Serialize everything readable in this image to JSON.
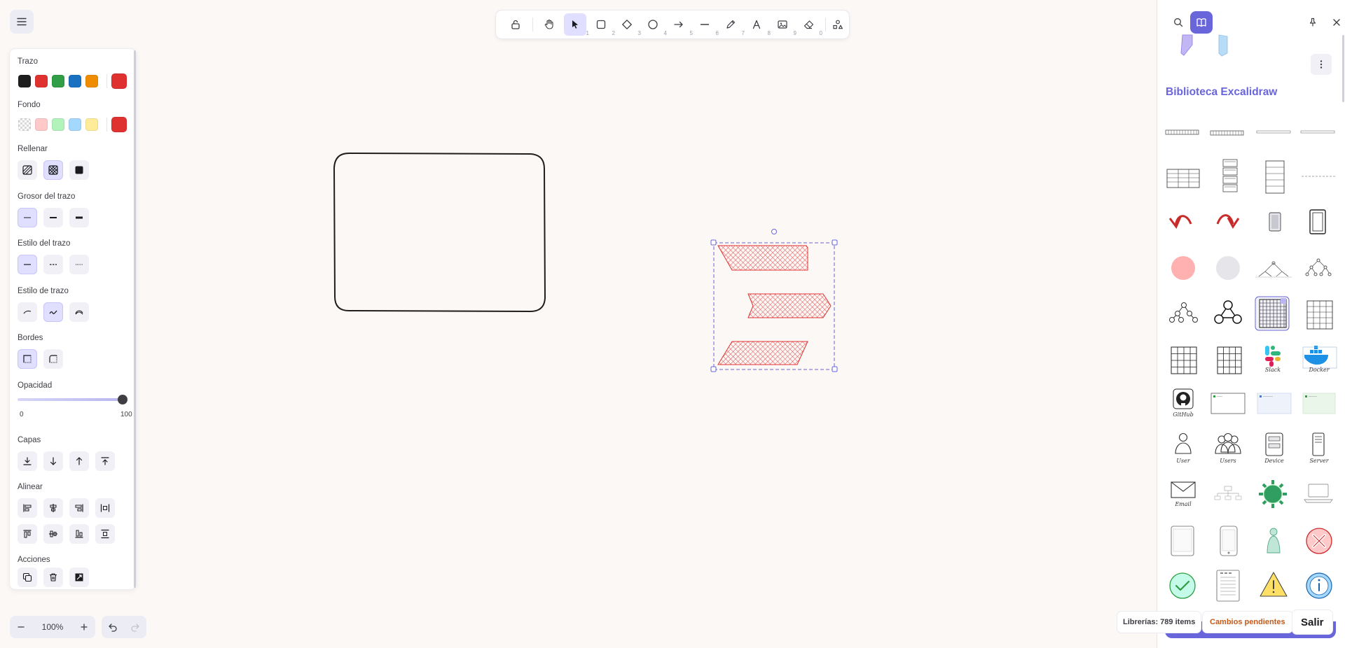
{
  "toolbar": {
    "tools": [
      {
        "name": "lock",
        "key": ""
      },
      {
        "name": "hand",
        "key": ""
      },
      {
        "name": "selection",
        "key": "1",
        "active": true
      },
      {
        "name": "rectangle",
        "key": "2"
      },
      {
        "name": "diamond",
        "key": "3"
      },
      {
        "name": "ellipse",
        "key": "4"
      },
      {
        "name": "arrow",
        "key": "5"
      },
      {
        "name": "line",
        "key": "6"
      },
      {
        "name": "draw",
        "key": "7"
      },
      {
        "name": "text",
        "key": "8"
      },
      {
        "name": "image",
        "key": "9"
      },
      {
        "name": "eraser",
        "key": "0"
      },
      {
        "name": "more-tools",
        "key": ""
      }
    ]
  },
  "props": {
    "stroke": {
      "label": "Trazo",
      "colors": [
        "#1e1e1e",
        "#e03131",
        "#2f9e44",
        "#1971c2",
        "#f08c00"
      ],
      "current": "#e03131"
    },
    "background": {
      "label": "Fondo",
      "colors": [
        "transparent",
        "#ffc9c9",
        "#b2f2bb",
        "#a5d8ff",
        "#ffec99"
      ],
      "current": "#e03131"
    },
    "fill": {
      "label": "Rellenar",
      "active": "cross-hatch"
    },
    "stroke_width": {
      "label": "Grosor del trazo",
      "active": "thin"
    },
    "stroke_style": {
      "label": "Estilo del trazo",
      "active": "solid"
    },
    "sloppiness": {
      "label": "Estilo de trazo",
      "active": "artist"
    },
    "edges": {
      "label": "Bordes",
      "active": "sharp"
    },
    "opacity": {
      "label": "Opacidad",
      "min": "0",
      "max": "100",
      "value": 100
    },
    "layers": {
      "label": "Capas"
    },
    "align": {
      "label": "Alinear"
    },
    "actions": {
      "label": "Acciones"
    }
  },
  "zoom": {
    "value": "100%"
  },
  "library": {
    "title": "Biblioteca Excalidraw",
    "labels": [
      "Slack",
      "Docker",
      "GitHub",
      "User",
      "Users",
      "Device",
      "Server",
      "Email"
    ],
    "count": "Librerías: 789 items",
    "pending": "Cambios pendientes",
    "exit": "Salir"
  },
  "colors": {
    "accent": "#6965db",
    "canvas": "#fcf8f6",
    "selection": "#6965db"
  }
}
